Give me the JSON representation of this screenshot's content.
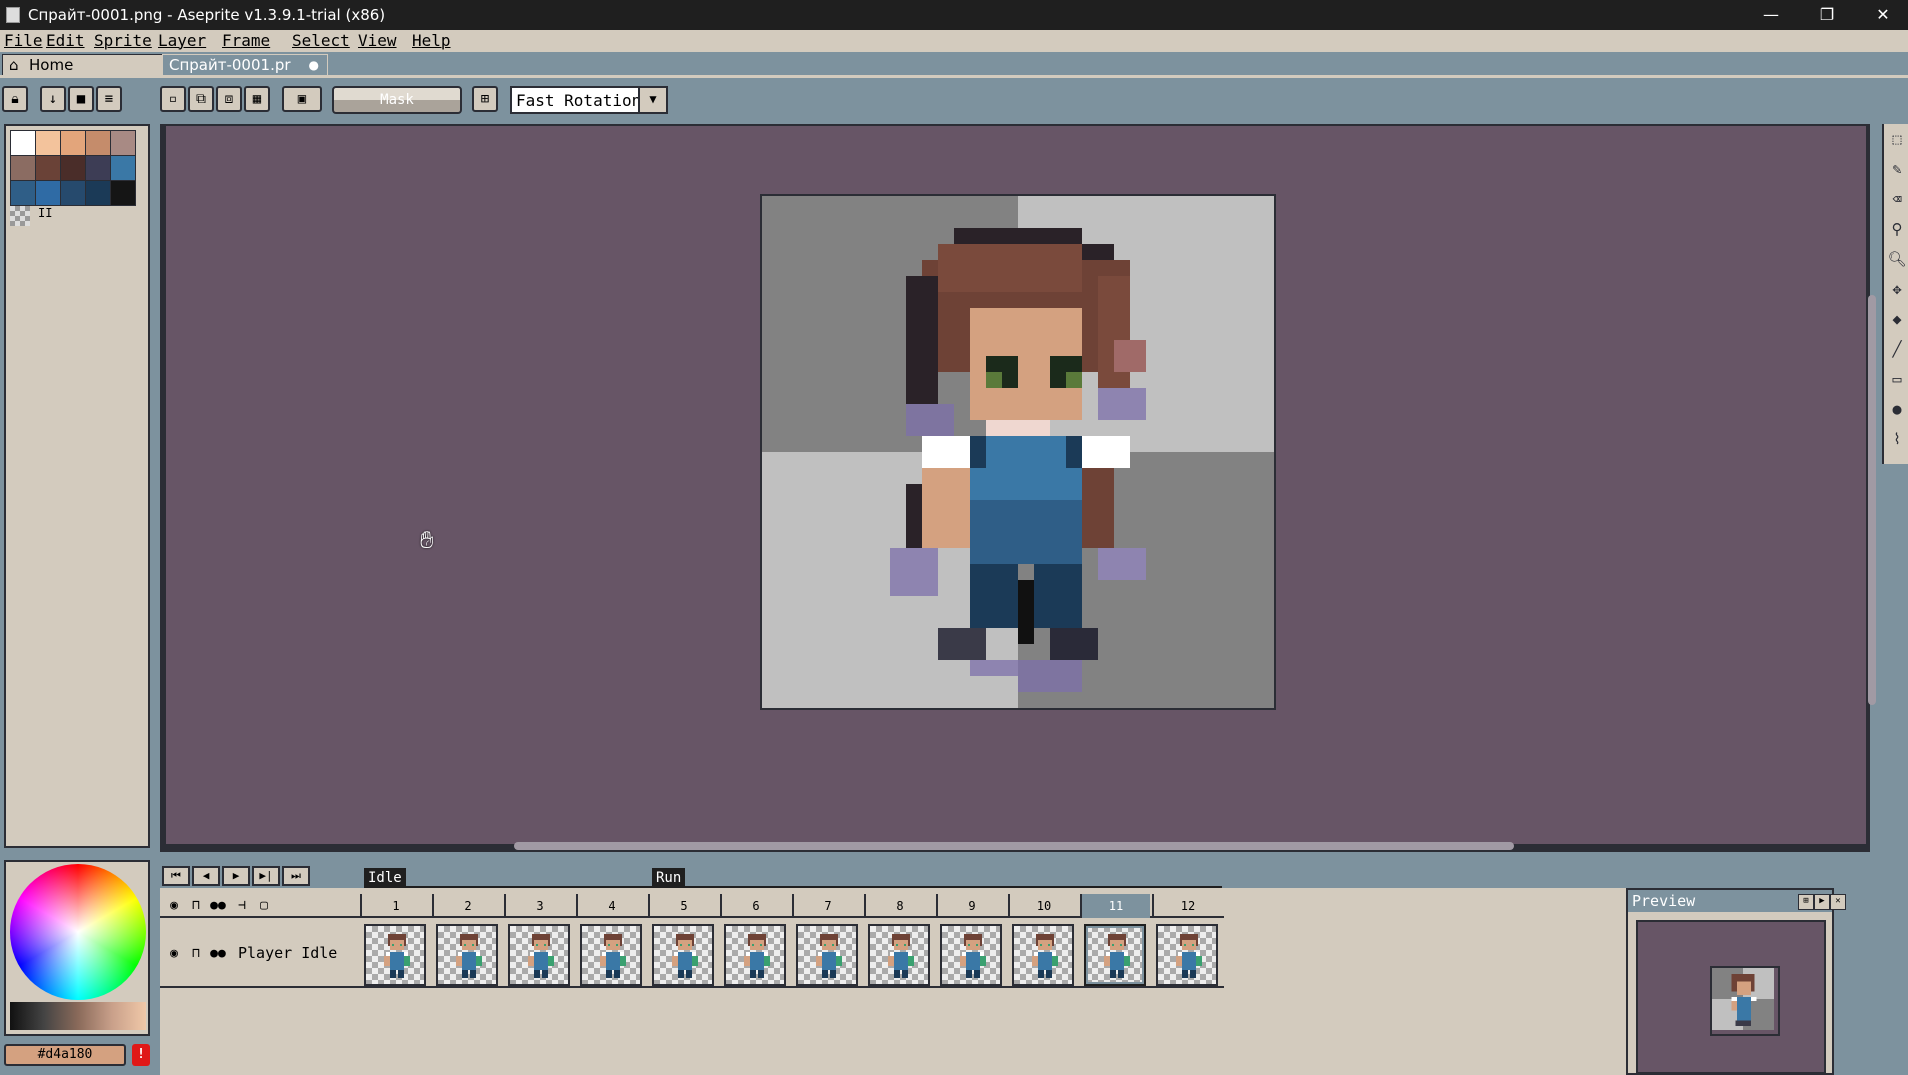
{
  "window": {
    "title": "Спрайт-0001.png - Aseprite v1.3.9.1-trial (x86)",
    "minimize": "—",
    "restore": "❐",
    "close": "✕"
  },
  "menu": [
    "File",
    "Edit",
    "Sprite",
    "Layer",
    "Frame",
    "Select",
    "View",
    "Help"
  ],
  "tabs": {
    "home": "Home",
    "file": "Спрайт-0001.pr"
  },
  "toolbar": {
    "mask_label": "Mask",
    "rotation": "Fast Rotation"
  },
  "palette": {
    "colors": [
      "#ffffff",
      "#f3c39c",
      "#e3a57b",
      "#c58c6b",
      "#a88a84",
      "#8b6c62",
      "#6a4237",
      "#4a2d29",
      "#3d3d55",
      "#3a78a6",
      "#2f5e87",
      "#2f6ba5",
      "#264a6d",
      "#1b3a57",
      "#151515"
    ],
    "page": "II"
  },
  "color": {
    "hex": "#d4a180",
    "warning": "!"
  },
  "timeline": {
    "tags": [
      {
        "name": "Idle"
      },
      {
        "name": "Run"
      }
    ],
    "frames": [
      "1",
      "2",
      "3",
      "4",
      "5",
      "6",
      "7",
      "8",
      "9",
      "10",
      "11",
      "12"
    ],
    "active_frame": "11",
    "layer_name": "Player Idle"
  },
  "preview": {
    "title": "Preview"
  }
}
